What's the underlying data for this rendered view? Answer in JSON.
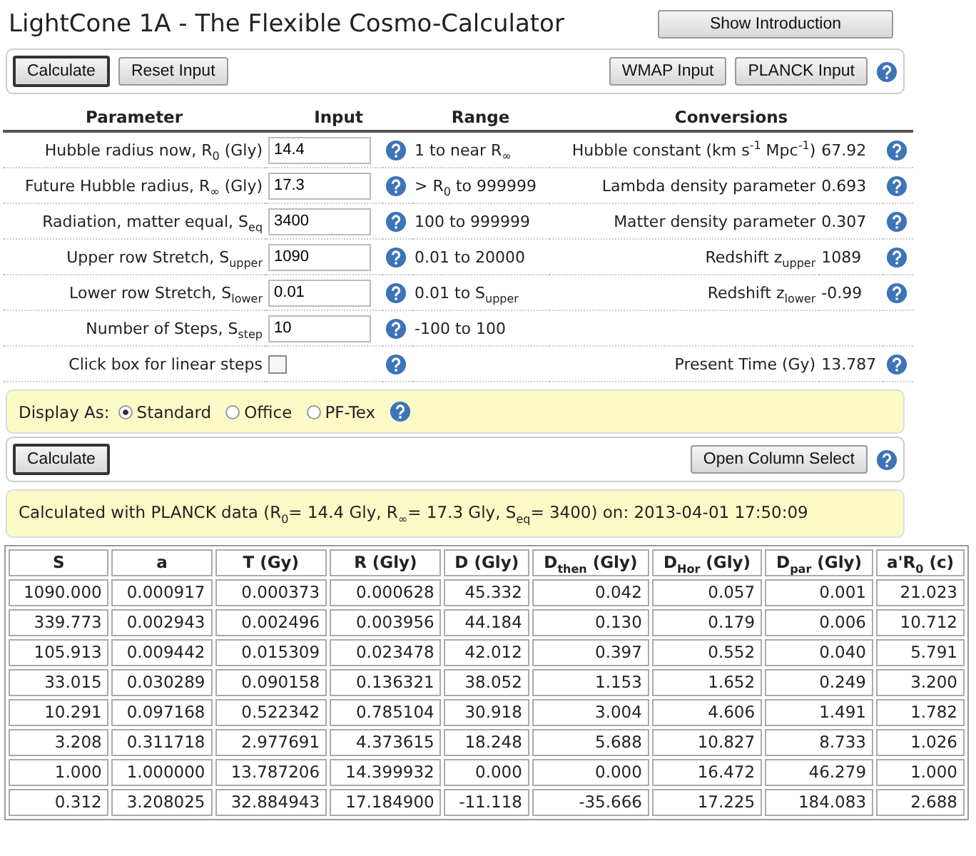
{
  "title": "LightCone 1A - The Flexible Cosmo-Calculator",
  "intro_button": "Show Introduction",
  "toolbar": {
    "left_buttons": [
      "Calculate",
      "Reset Input"
    ],
    "right_buttons": [
      "WMAP Input",
      "PLANCK Input"
    ]
  },
  "parameters": {
    "columns": [
      "Parameter",
      "Input",
      "Range",
      "Conversions"
    ],
    "rows": [
      {
        "kind": "input",
        "label": "Hubble radius now, R$_{0}$ (Gly)",
        "value": "14.4",
        "range": "1 to near R$_{∞}$",
        "conversion_label": "Hubble constant (km s$^{-1}$ Mpc$^{-1}$)",
        "conversion_value": "67.92"
      },
      {
        "kind": "input",
        "label": "Future Hubble radius, R$_{∞}$ (Gly)",
        "value": "17.3",
        "range": "> R$_{0}$ to 999999",
        "conversion_label": "Lambda density parameter",
        "conversion_value": "0.693"
      },
      {
        "kind": "input",
        "label": "Radiation, matter equal, S$_{eq}$",
        "value": "3400",
        "range": "100 to 999999",
        "conversion_label": "Matter density parameter",
        "conversion_value": "0.307"
      },
      {
        "kind": "input",
        "label": "Upper row Stretch, S$_{upper}$",
        "value": "1090",
        "range": "0.01 to 20000",
        "conversion_label": "Redshift z$_{upper}$",
        "conversion_value": "1089"
      },
      {
        "kind": "input",
        "label": "Lower row Stretch, S$_{lower}$",
        "value": "0.01",
        "range": "0.01 to S$_{upper}$",
        "conversion_label": "Redshift z$_{lower}$",
        "conversion_value": "-0.99"
      },
      {
        "kind": "input",
        "label": "Number of Steps, S$_{step}$",
        "value": "10",
        "range": "-100 to 100"
      },
      {
        "kind": "checkbox",
        "label": "Click box for linear steps",
        "checked": false,
        "conversion_label": "Present Time (Gy)",
        "conversion_value": "13.787"
      }
    ]
  },
  "display": {
    "label": "Display As:",
    "options": [
      {
        "label": "Standard",
        "selected": true
      },
      {
        "label": "Office",
        "selected": false
      },
      {
        "label": "PF-Tex",
        "selected": false
      }
    ]
  },
  "actions": {
    "calculate": "Calculate",
    "column_select": "Open Column Select"
  },
  "info": "Calculated with PLANCK data (R$_{0}$= 14.4 Gly, R$_{∞}$= 17.3 Gly, S$_{eq}$= 3400) on: 2013-04-01 17:50:09",
  "results": {
    "columns": [
      "S",
      "a",
      "T (Gy)",
      "R (Gly)",
      "D (Gly)",
      "D$_{then}$ (Gly)",
      "D$_{Hor}$ (Gly)",
      "D$_{par}$ (Gly)",
      "a'R$_{0}$ (c)"
    ],
    "rows": [
      [
        "1090.000",
        "0.000917",
        "0.000373",
        "0.000628",
        "45.332",
        "0.042",
        "0.057",
        "0.001",
        "21.023"
      ],
      [
        "339.773",
        "0.002943",
        "0.002496",
        "0.003956",
        "44.184",
        "0.130",
        "0.179",
        "0.006",
        "10.712"
      ],
      [
        "105.913",
        "0.009442",
        "0.015309",
        "0.023478",
        "42.012",
        "0.397",
        "0.552",
        "0.040",
        "5.791"
      ],
      [
        "33.015",
        "0.030289",
        "0.090158",
        "0.136321",
        "38.052",
        "1.153",
        "1.652",
        "0.249",
        "3.200"
      ],
      [
        "10.291",
        "0.097168",
        "0.522342",
        "0.785104",
        "30.918",
        "3.004",
        "4.606",
        "1.491",
        "1.782"
      ],
      [
        "3.208",
        "0.311718",
        "2.977691",
        "4.373615",
        "18.248",
        "5.688",
        "10.827",
        "8.733",
        "1.026"
      ],
      [
        "1.000",
        "1.000000",
        "13.787206",
        "14.399932",
        "0.000",
        "0.000",
        "16.472",
        "46.279",
        "1.000"
      ],
      [
        "0.312",
        "3.208025",
        "32.884943",
        "17.184900",
        "-11.118",
        "-35.666",
        "17.225",
        "184.083",
        "2.688"
      ]
    ]
  }
}
